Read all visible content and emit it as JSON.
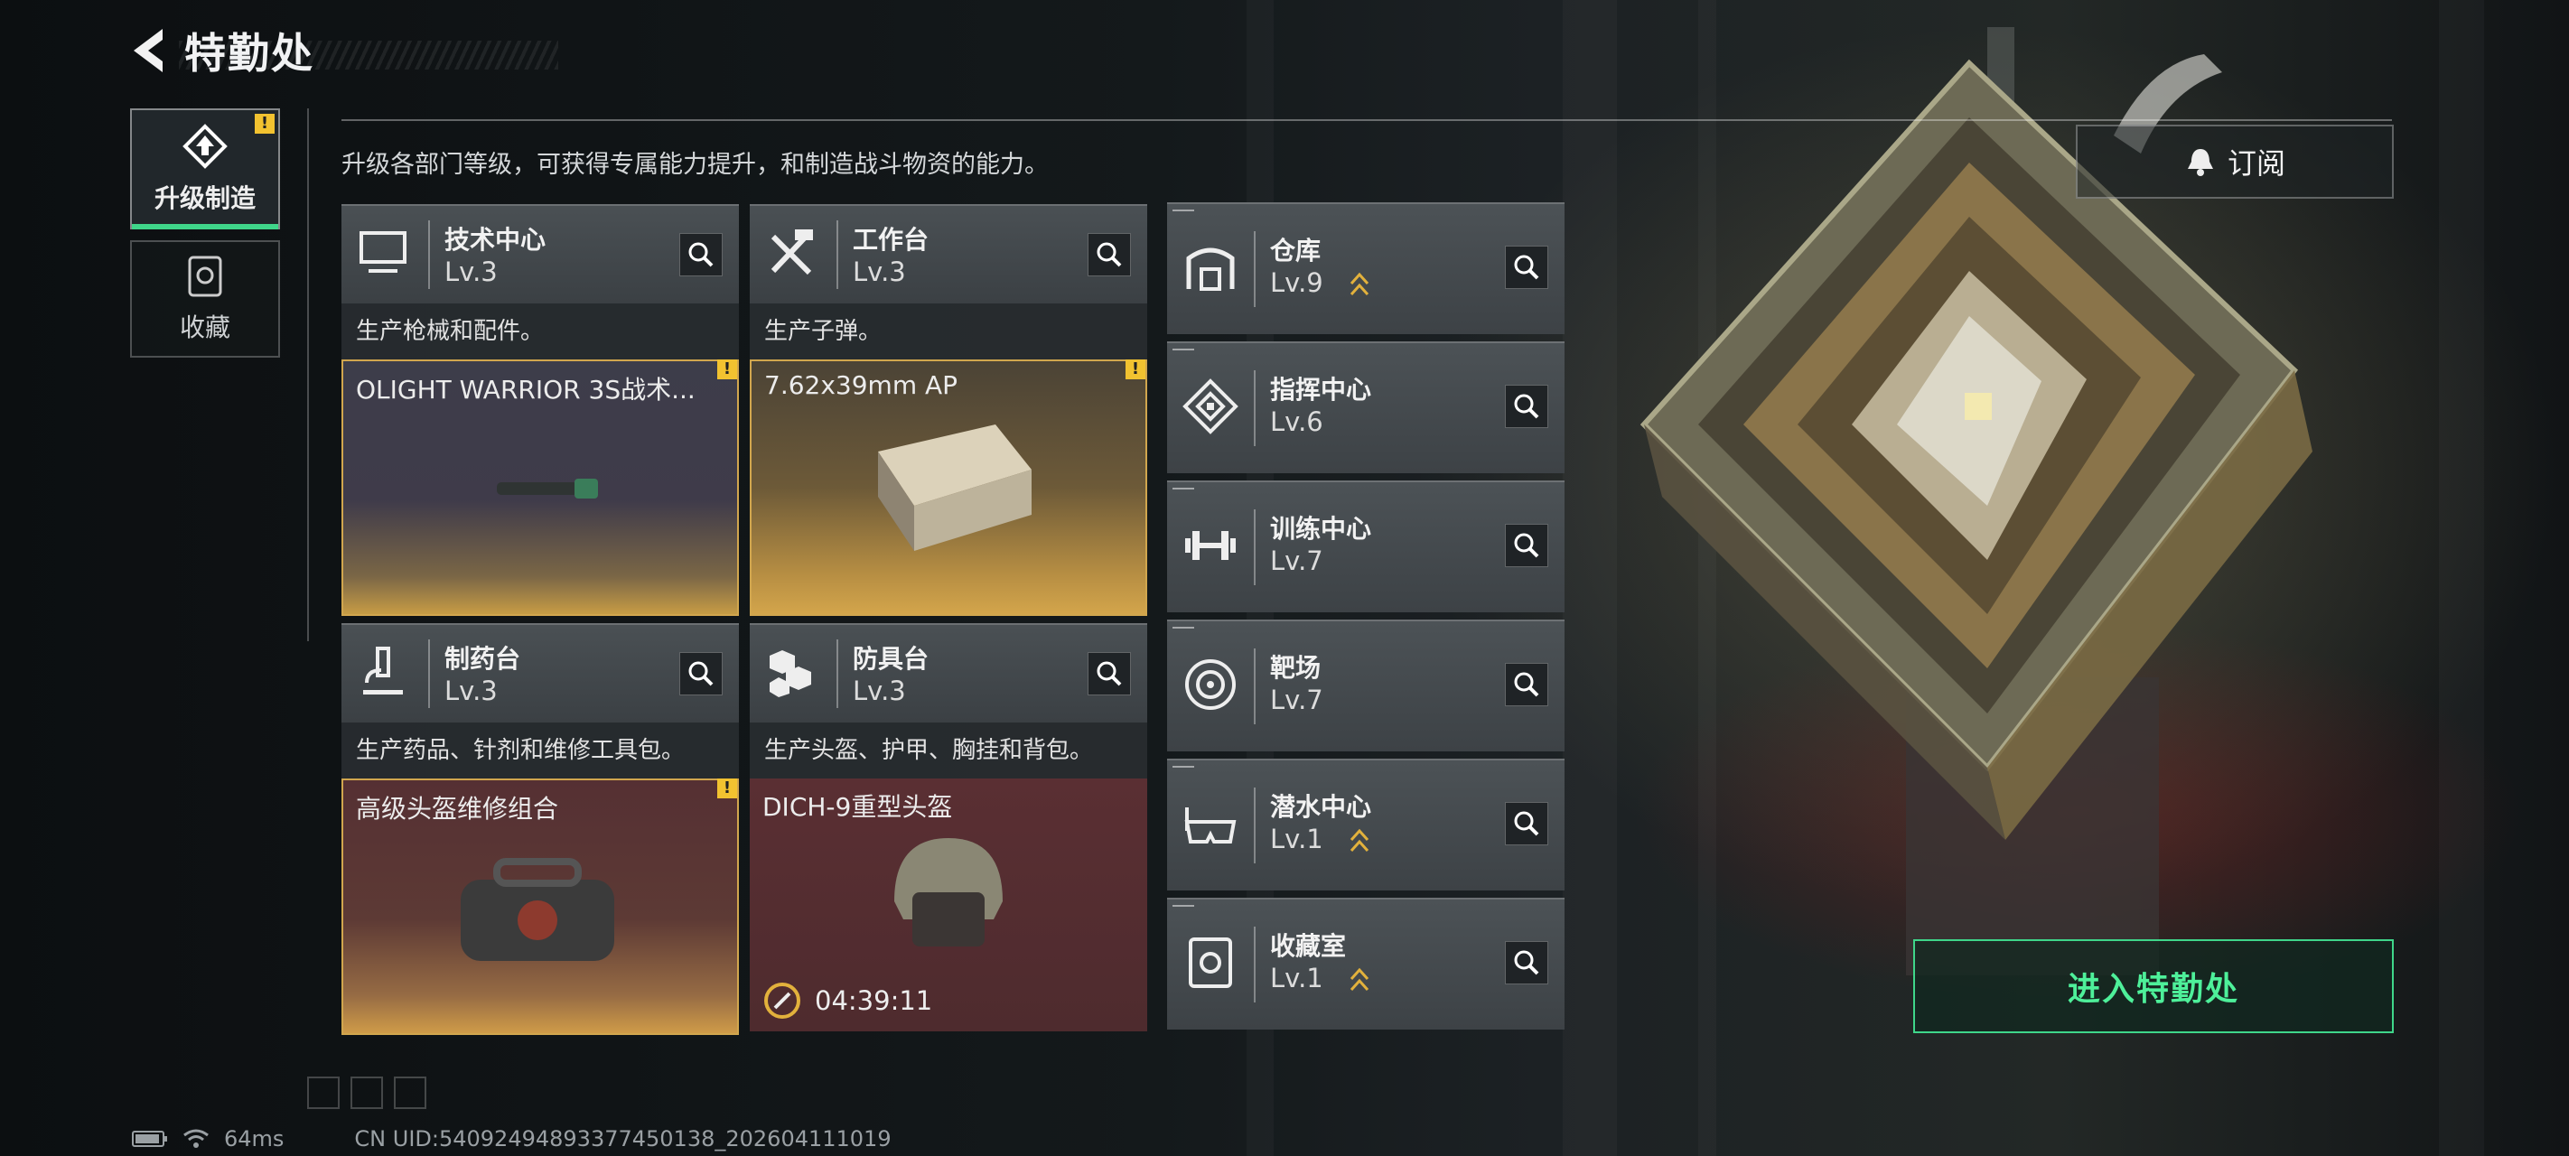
{
  "header": {
    "title": "特勤处"
  },
  "sidebar": {
    "tabs": [
      {
        "label": "升级制造",
        "icon": "upgrade-icon",
        "alert": "!"
      },
      {
        "label": "收藏",
        "icon": "collection-icon"
      }
    ]
  },
  "description": "升级各部门等级，可获得专属能力提升，和制造战斗物资的能力。",
  "subscribe": {
    "label": "订阅",
    "icon": "bell-icon"
  },
  "cards": [
    {
      "name": "技术中心",
      "level": "Lv.3",
      "desc": "生产枪械和配件。",
      "product": "OLIGHT WARRIOR 3S战术...",
      "alert": "!",
      "icon": "computer-icon"
    },
    {
      "name": "工作台",
      "level": "Lv.3",
      "desc": "生产子弹。",
      "product": "7.62x39mm AP",
      "alert": "!",
      "icon": "tools-icon"
    },
    {
      "name": "制药台",
      "level": "Lv.3",
      "desc": "生产药品、针剂和维修工具包。",
      "product": "高级头盔维修组合",
      "alert": "!",
      "icon": "microscope-icon"
    },
    {
      "name": "防具台",
      "level": "Lv.3",
      "desc": "生产头盔、护甲、胸挂和背包。",
      "product": "DICH-9重型头盔",
      "timer": "04:39:11",
      "icon": "armor-icon"
    }
  ],
  "facilities": [
    {
      "name": "仓库",
      "level": "Lv.9",
      "upgradable": true,
      "icon": "warehouse-icon"
    },
    {
      "name": "指挥中心",
      "level": "Lv.6",
      "upgradable": false,
      "icon": "command-icon"
    },
    {
      "name": "训练中心",
      "level": "Lv.7",
      "upgradable": false,
      "icon": "dumbbell-icon"
    },
    {
      "name": "靶场",
      "level": "Lv.7",
      "upgradable": false,
      "icon": "target-icon"
    },
    {
      "name": "潜水中心",
      "level": "Lv.1",
      "upgradable": true,
      "icon": "diving-mask-icon"
    },
    {
      "name": "收藏室",
      "level": "Lv.1",
      "upgradable": true,
      "icon": "collection-room-icon"
    }
  ],
  "enter_button": {
    "label": "进入特勤处"
  },
  "status": {
    "ping": "64ms",
    "uid": "CN UID:5409249489337745013​8_202604111019"
  },
  "colors": {
    "accent_green": "#3fd68a",
    "alert_yellow": "#f2c230",
    "gold_border": "#d1a64e"
  }
}
